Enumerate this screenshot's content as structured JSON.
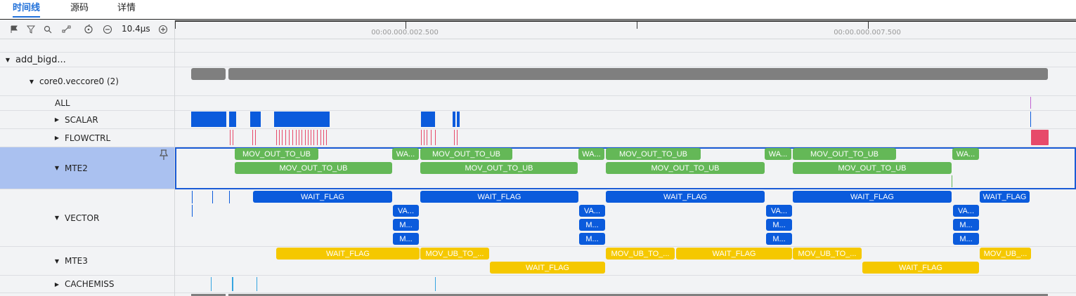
{
  "tabs": [
    {
      "label": "时间线",
      "active": true
    },
    {
      "label": "源码",
      "active": false
    },
    {
      "label": "详情",
      "active": false
    }
  ],
  "toolbar": {
    "icons": [
      "flag-icon",
      "filter-icon",
      "search-icon",
      "marker-icon",
      "reset-icon",
      "zoom-out-icon",
      "zoom-in-icon"
    ],
    "zoom_label": "10.4μs"
  },
  "ruler": {
    "labels": [
      "00:00.000.002.500",
      "00:00.000.007.500"
    ]
  },
  "tree": {
    "root": "add_bigd...",
    "core": "core0.veccore0 (2)",
    "rows": [
      "ALL",
      "SCALAR",
      "FLOWCTRL",
      "MTE2",
      "VECTOR",
      "MTE3",
      "CACHEMISS"
    ]
  },
  "bars": {
    "mov_out_to_ub": "MOV_OUT_TO_UB",
    "wa_short": "WA...",
    "wait_flag": "WAIT_FLAG",
    "va_short": "VA...",
    "m_short": "M...",
    "mov_ub_to": "MOV_UB_TO_...",
    "mov_ub_short": "MOV_UB_..."
  },
  "colors": {
    "accent": "#1e6fd9",
    "gray": "#7f7f7f",
    "green": "#64b857",
    "blue": "#0b5bdc",
    "yellow": "#f5c800",
    "red": "#e74a6a"
  }
}
